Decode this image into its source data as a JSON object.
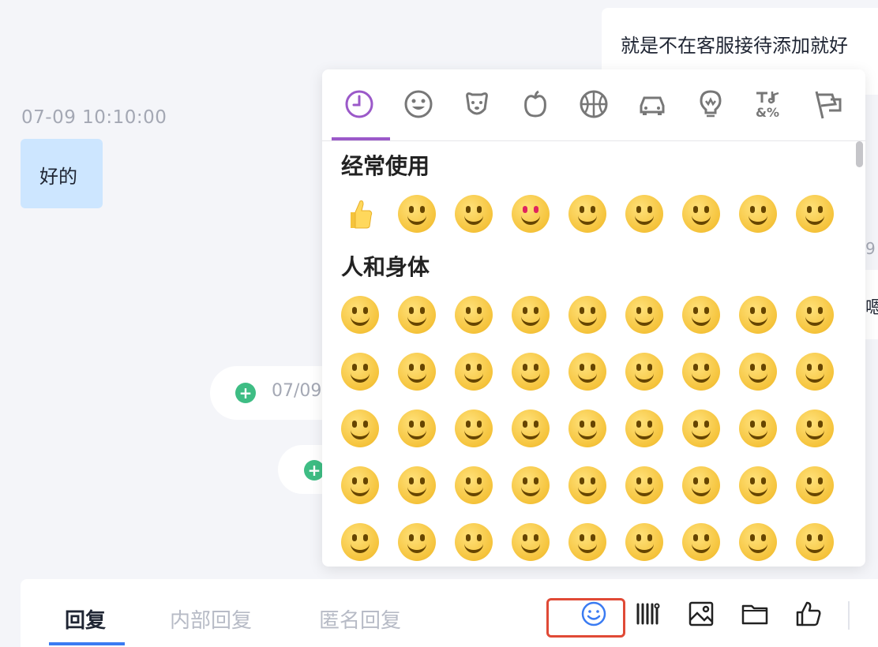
{
  "chat": {
    "right_top_text": "就是不在客服接待添加就好",
    "left_timestamp": "07-09 10:10:00",
    "left_bubble_text": "好的",
    "pill_partial_text": "07/09",
    "right_card_text": "嗯",
    "right_fragment": "9"
  },
  "emoji_panel": {
    "tabs": [
      {
        "icon": "clock-icon",
        "active": true
      },
      {
        "icon": "smiley-icon"
      },
      {
        "icon": "dog-face-icon"
      },
      {
        "icon": "apple-icon"
      },
      {
        "icon": "basketball-icon"
      },
      {
        "icon": "car-icon"
      },
      {
        "icon": "lightbulb-icon"
      },
      {
        "icon": "symbols-icon"
      },
      {
        "icon": "flags-icon"
      }
    ],
    "sections": [
      {
        "title": "经常使用"
      },
      {
        "title": "人和身体"
      }
    ],
    "accent_color": "#9b59c9"
  },
  "toolbar": {
    "tabs": [
      {
        "label": "回复",
        "active": true
      },
      {
        "label": "内部回复"
      },
      {
        "label": "匿名回复"
      }
    ],
    "tools": [
      {
        "icon": "emoji-icon",
        "highlighted": true
      },
      {
        "icon": "quick-phrases-icon"
      },
      {
        "icon": "image-icon"
      },
      {
        "icon": "folder-icon"
      },
      {
        "icon": "thumbs-up-icon"
      }
    ],
    "active_underline_color": "#3a7bf2",
    "highlight_box_color": "#e04a36"
  }
}
